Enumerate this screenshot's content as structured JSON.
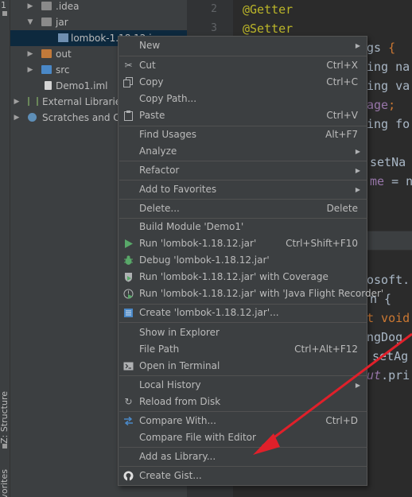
{
  "toolstrip": {
    "top_number": "1",
    "structure_label": "Z: Structure",
    "favorites_label": "vorites"
  },
  "tree": [
    {
      "label": ".idea",
      "arrow": "▶",
      "icon": "folder-icon"
    },
    {
      "label": "jar",
      "arrow": "▼",
      "icon": "folder-icon"
    },
    {
      "label": "lombok-1.18.12.j",
      "arrow": "",
      "icon": "jar-icon"
    },
    {
      "label": "out",
      "arrow": "▶",
      "icon": "folder-orange-icon"
    },
    {
      "label": "src",
      "arrow": "▶",
      "icon": "folder-blue-icon"
    },
    {
      "label": "Demo1.iml",
      "arrow": "",
      "icon": "file-icon"
    },
    {
      "label": "External Libraries",
      "arrow": "▶",
      "icon": "library-icon"
    },
    {
      "label": "Scratches and Con",
      "arrow": "▶",
      "icon": "scratches-icon"
    }
  ],
  "editor": {
    "line_numbers": [
      "2",
      "3"
    ],
    "lines": [
      {
        "parts": [
          {
            "cls": "ann",
            "text": "@Getter"
          }
        ]
      },
      {
        "parts": [
          {
            "cls": "ann",
            "text": "@Setter"
          }
        ]
      },
      {
        "parts": [
          {
            "cls": "plain",
            "text": "gs "
          },
          {
            "cls": "kw",
            "text": "{"
          }
        ]
      },
      {
        "parts": [
          {
            "cls": "plain",
            "text": "ing na"
          }
        ]
      },
      {
        "parts": [
          {
            "cls": "plain",
            "text": "ing va"
          }
        ]
      },
      {
        "parts": [
          {
            "cls": "field",
            "text": "age"
          },
          {
            "cls": "kw",
            "text": ";"
          }
        ]
      },
      {
        "parts": [
          {
            "cls": "plain",
            "text": "ing fo"
          }
        ]
      },
      {
        "parts": [
          {
            "cls": "plain",
            "text": "setNa"
          }
        ]
      },
      {
        "parts": [
          {
            "cls": "field",
            "text": "me"
          },
          {
            "cls": "plain",
            "text": " = na"
          }
        ]
      }
    ],
    "lines2": [
      {
        "parts": [
          {
            "cls": "plain",
            "text": "osoft."
          }
        ]
      },
      {
        "parts": [
          {
            "cls": "plain",
            "text": "n {"
          }
        ]
      },
      {
        "parts": [
          {
            "cls": "kw",
            "text": "t void"
          }
        ]
      },
      {
        "parts": [
          {
            "cls": "plain",
            "text": "ngDog"
          }
        ]
      },
      {
        "parts": [
          {
            "cls": "plain",
            "text": "setAg"
          }
        ]
      },
      {
        "parts": [
          {
            "cls": "ital",
            "text": "ut"
          },
          {
            "cls": "plain",
            "text": ".pri"
          }
        ]
      }
    ]
  },
  "menu": {
    "items": [
      {
        "label": "New",
        "shortcut": "",
        "submenu": true,
        "icon": ""
      },
      {
        "label": "Cut",
        "shortcut": "Ctrl+X",
        "submenu": false,
        "icon": "cut-icon"
      },
      {
        "label": "Copy",
        "shortcut": "Ctrl+C",
        "submenu": false,
        "icon": "copy-icon"
      },
      {
        "label": "Copy Path...",
        "shortcut": "",
        "submenu": false,
        "icon": ""
      },
      {
        "label": "Paste",
        "shortcut": "Ctrl+V",
        "submenu": false,
        "icon": "paste-icon"
      },
      {
        "label": "Find Usages",
        "shortcut": "Alt+F7",
        "submenu": false,
        "icon": ""
      },
      {
        "label": "Analyze",
        "shortcut": "",
        "submenu": true,
        "icon": ""
      },
      {
        "label": "Refactor",
        "shortcut": "",
        "submenu": true,
        "icon": ""
      },
      {
        "label": "Add to Favorites",
        "shortcut": "",
        "submenu": true,
        "icon": ""
      },
      {
        "label": "Delete...",
        "shortcut": "Delete",
        "submenu": false,
        "icon": ""
      },
      {
        "label": "Build Module 'Demo1'",
        "shortcut": "",
        "submenu": false,
        "icon": ""
      },
      {
        "label": "Run 'lombok-1.18.12.jar'",
        "shortcut": "Ctrl+Shift+F10",
        "submenu": false,
        "icon": "run-icon"
      },
      {
        "label": "Debug 'lombok-1.18.12.jar'",
        "shortcut": "",
        "submenu": false,
        "icon": "debug-icon"
      },
      {
        "label": "Run 'lombok-1.18.12.jar' with Coverage",
        "shortcut": "",
        "submenu": false,
        "icon": "coverage-icon"
      },
      {
        "label": "Run 'lombok-1.18.12.jar' with 'Java Flight Recorder'",
        "shortcut": "",
        "submenu": false,
        "icon": "profiler-icon"
      },
      {
        "label": "Create 'lombok-1.18.12.jar'...",
        "shortcut": "",
        "submenu": false,
        "icon": "config-icon"
      },
      {
        "label": "Show in Explorer",
        "shortcut": "",
        "submenu": false,
        "icon": ""
      },
      {
        "label": "File Path",
        "shortcut": "Ctrl+Alt+F12",
        "submenu": false,
        "icon": ""
      },
      {
        "label": "Open in Terminal",
        "shortcut": "",
        "submenu": false,
        "icon": "terminal-icon"
      },
      {
        "label": "Local History",
        "shortcut": "",
        "submenu": true,
        "icon": ""
      },
      {
        "label": "Reload from Disk",
        "shortcut": "",
        "submenu": false,
        "icon": "reload-icon"
      },
      {
        "label": "Compare With...",
        "shortcut": "Ctrl+D",
        "submenu": false,
        "icon": "compare-icon"
      },
      {
        "label": "Compare File with Editor",
        "shortcut": "",
        "submenu": false,
        "icon": ""
      },
      {
        "label": "Add as Library...",
        "shortcut": "",
        "submenu": false,
        "icon": ""
      },
      {
        "label": "Create Gist...",
        "shortcut": "",
        "submenu": false,
        "icon": "github-icon"
      }
    ]
  },
  "colors": {
    "menu_bg": "#3c3f41",
    "annotation_arrow": "#e0202a",
    "run_green": "#59a869"
  }
}
